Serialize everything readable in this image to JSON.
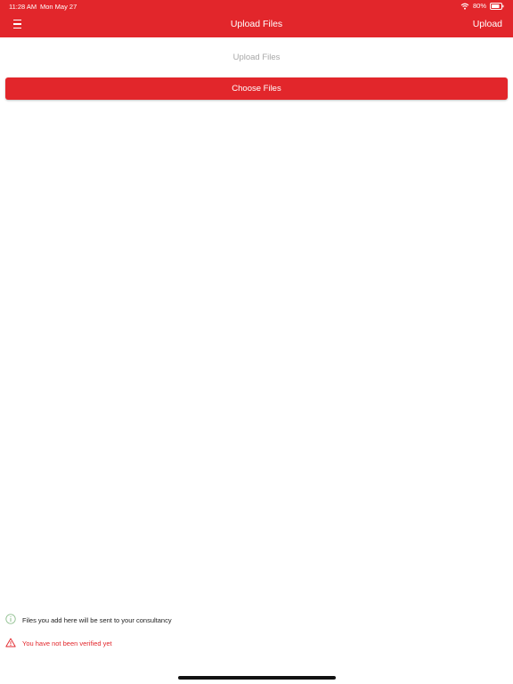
{
  "status_bar": {
    "time": "11:28 AM",
    "date": "Mon May 27",
    "battery": "80%",
    "wifi_icon": "wifi-icon",
    "battery_icon": "battery-icon"
  },
  "nav": {
    "menu_icon": "hamburger-menu-icon",
    "title": "Upload Files",
    "upload_label": "Upload"
  },
  "main": {
    "section_title": "Upload Files",
    "choose_label": "Choose Files"
  },
  "footer": {
    "info_icon": "info-icon",
    "info_text": "Files you add here will be sent to your consultancy",
    "warning_icon": "warning-icon",
    "warning_text": "You have not been verified yet"
  },
  "colors": {
    "accent": "#e2262b",
    "info_icon": "#8fbf8f",
    "muted_text": "#a8a8a8"
  }
}
